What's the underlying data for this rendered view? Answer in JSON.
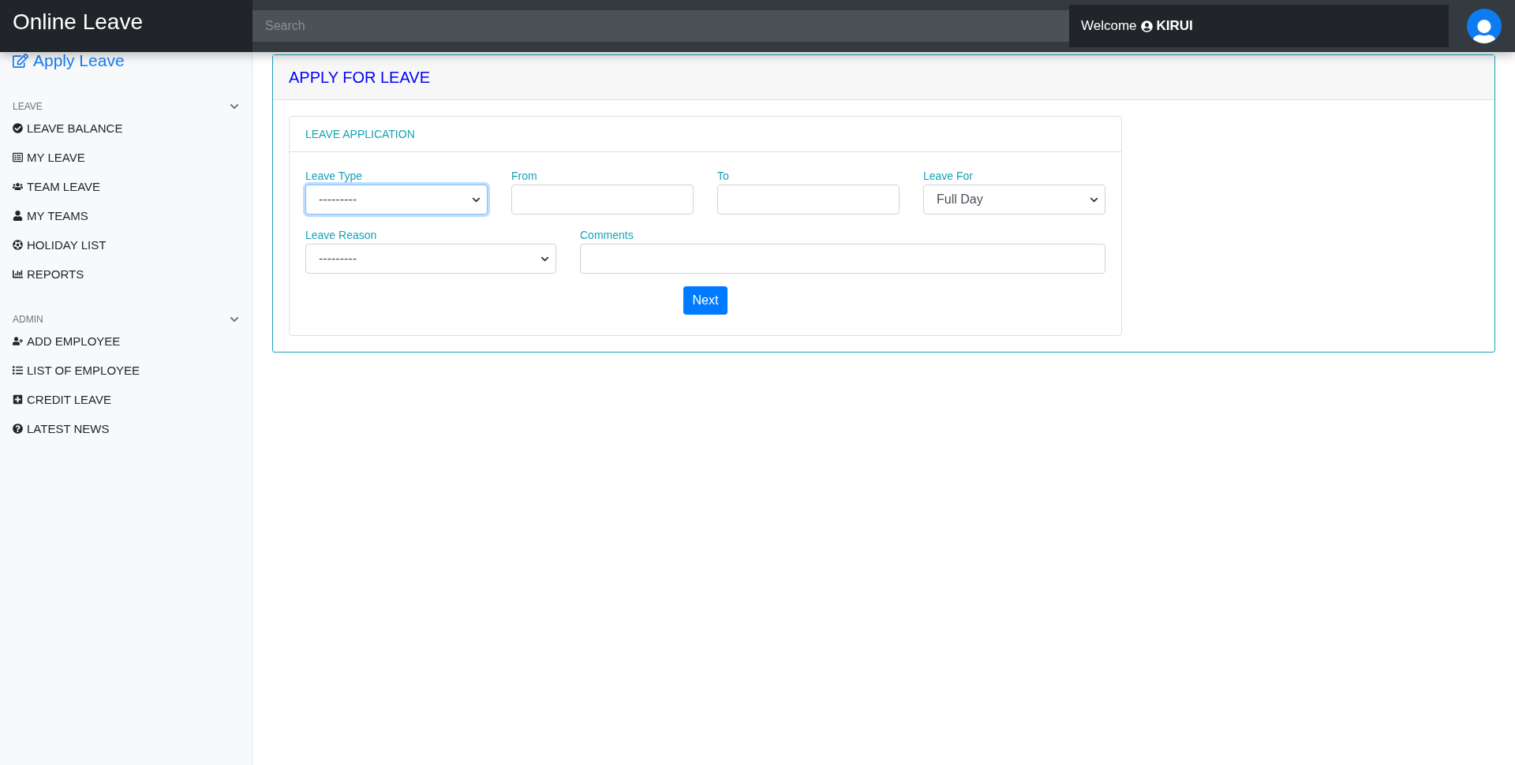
{
  "brand": "Online Leave",
  "search": {
    "placeholder": "Search"
  },
  "welcome": {
    "label": "Welcome",
    "user": "KIRUI"
  },
  "sidebar": {
    "title": "Apply Leave",
    "sections": [
      {
        "label": "LEAVE",
        "expanded": true,
        "items": [
          "LEAVE BALANCE",
          "MY LEAVE",
          "TEAM LEAVE",
          "MY TEAMS",
          "HOLIDAY LIST",
          "REPORTS"
        ]
      },
      {
        "label": "ADMIN",
        "expanded": true,
        "items": [
          "ADD EMPLOYEE",
          "LIST OF EMPLOYEE",
          "CREDIT LEAVE",
          "LATEST NEWS"
        ]
      }
    ]
  },
  "page_title": "APPLY FOR LEAVE",
  "form": {
    "title": "LEAVE APPLICATION",
    "rows": [
      [
        {
          "label": "Leave Type",
          "kind": "select",
          "value": "---------",
          "focused": true
        },
        {
          "label": "From",
          "kind": "text"
        },
        {
          "label": "To",
          "kind": "text"
        },
        {
          "label": "Leave For",
          "kind": "select",
          "value": "Full Day",
          "focused": false
        }
      ],
      [
        {
          "label": "Leave Reason",
          "kind": "select",
          "value": "---------",
          "focused": false
        },
        {
          "label": "Comments",
          "kind": "text"
        }
      ]
    ],
    "submit": "Next"
  }
}
